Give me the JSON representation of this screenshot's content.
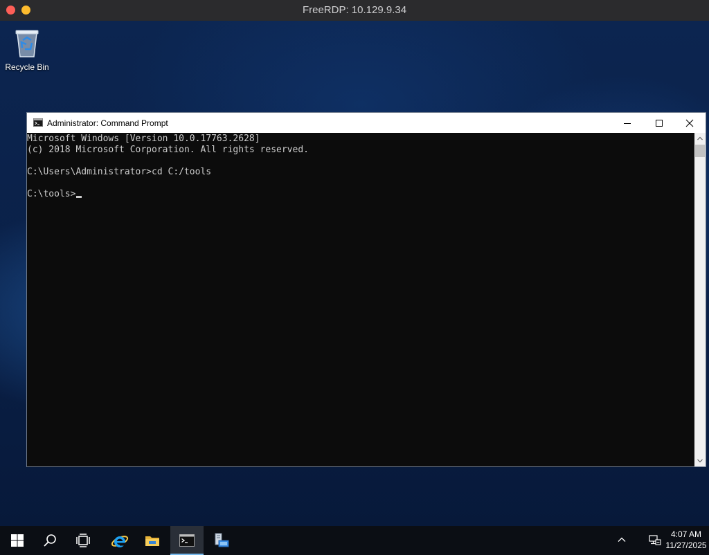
{
  "host_window": {
    "title": "FreeRDP: 10.129.9.34",
    "colors": {
      "close": "#ff5f57",
      "minimize": "#febc2e"
    }
  },
  "desktop": {
    "icons": [
      {
        "label": "Recycle Bin",
        "icon": "recycle-bin-icon"
      }
    ]
  },
  "cmd_window": {
    "title": "Administrator: Command Prompt",
    "icon": "command-prompt-icon",
    "controls": [
      "minimize-icon",
      "maximize-icon",
      "close-icon"
    ],
    "console_lines": [
      "Microsoft Windows [Version 10.0.17763.2628]",
      "(c) 2018 Microsoft Corporation. All rights reserved.",
      "",
      "C:\\Users\\Administrator>cd C:/tools",
      "",
      "C:\\tools>"
    ],
    "colors": {
      "background": "#0c0c0c",
      "text": "#cccccc"
    }
  },
  "taskbar": {
    "buttons": [
      {
        "icon": "windows-start-icon"
      },
      {
        "icon": "search-icon"
      },
      {
        "icon": "task-view-icon"
      },
      {
        "icon": "internet-explorer-icon"
      },
      {
        "icon": "file-explorer-icon"
      },
      {
        "icon": "command-prompt-icon",
        "active": true
      },
      {
        "icon": "server-manager-icon"
      }
    ],
    "tray_icons": [
      "chevron-up-icon",
      "network-icon"
    ],
    "clock": {
      "time": "4:07 AM",
      "date": "11/27/2025"
    },
    "colors": {
      "background": "#0b0e14",
      "active_underline": "#76b9ed"
    }
  }
}
